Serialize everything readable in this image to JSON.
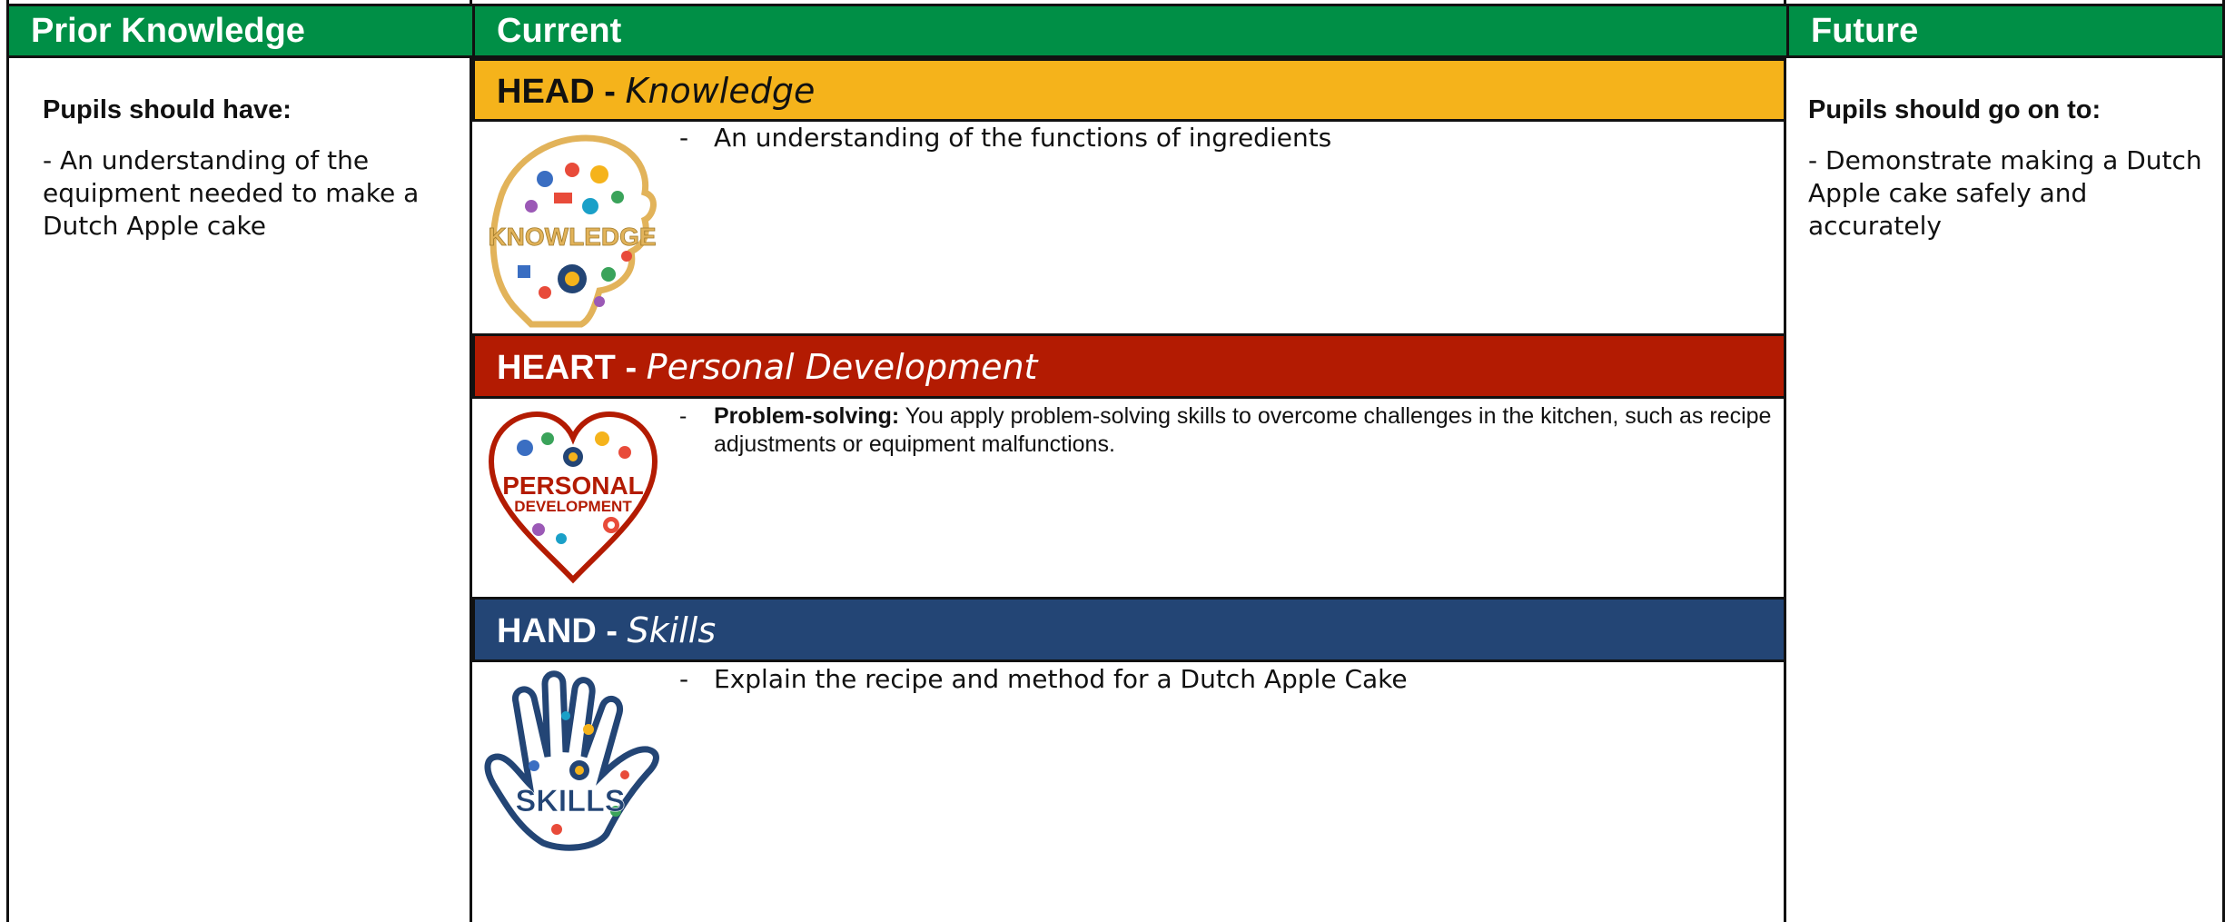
{
  "columns": {
    "prior": {
      "title": "Prior Knowledge",
      "subtitle": "Pupils should have:",
      "body": "- An understanding of the equipment needed to make a Dutch Apple cake"
    },
    "current": {
      "title": "Current"
    },
    "future": {
      "title": "Future",
      "subtitle": "Pupils should go on to:",
      "body": "- Demonstrate making a Dutch Apple cake safely and accurately"
    }
  },
  "sections": {
    "head": {
      "strong": "HEAD - ",
      "italic": "Knowledge",
      "bullet_dash": "-",
      "bullet": "An understanding of the functions of ingredients",
      "image_label": "KNOWLEDGE",
      "color": "#f5b31b"
    },
    "heart": {
      "strong": "HEART - ",
      "italic": "Personal Development",
      "bullet_dash": "-",
      "bullet_bold": "Problem-solving:",
      "bullet": " You apply problem-solving skills to overcome challenges in the kitchen, such as recipe adjustments or equipment malfunctions.",
      "image_label_1": "PERSONAL",
      "image_label_2": "DEVELOPMENT",
      "color": "#b31b02"
    },
    "hand": {
      "strong": "HAND - ",
      "italic": "Skills",
      "bullet_dash": "-",
      "bullet": "Explain the recipe and method for a Dutch Apple Cake",
      "image_label": "SKILLS",
      "color": "#234575"
    }
  },
  "theme": {
    "green": "#008f46",
    "border": "#111111"
  }
}
